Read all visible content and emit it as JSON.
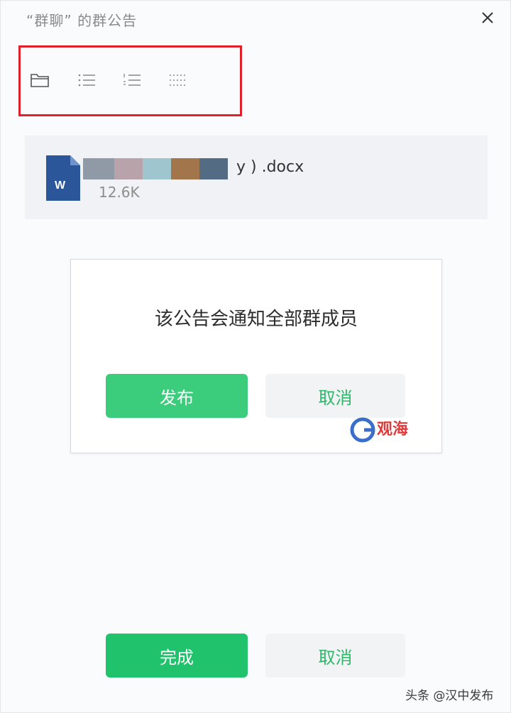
{
  "window": {
    "title": "“群聊” 的群公告"
  },
  "toolbar": {
    "tools": [
      {
        "icon": "folder-icon"
      },
      {
        "icon": "bullet-list-icon"
      },
      {
        "icon": "numbered-list-icon"
      },
      {
        "icon": "dotted-grid-icon"
      }
    ],
    "highlight_color": "#e0202a"
  },
  "attachment": {
    "file_type_letter": "W",
    "filename_visible": "y ) .docx",
    "size": "12.6K",
    "blur_colors": [
      "#8f9aa6",
      "#b8a3ab",
      "#9fc6cf",
      "#a2754a",
      "#546b84"
    ]
  },
  "confirm_dialog": {
    "message": "该公告会通知全部群成员",
    "publish_label": "发布",
    "cancel_label": "取消"
  },
  "footer": {
    "done_label": "完成",
    "cancel_label": "取消"
  },
  "watermark": {
    "logo_text": "观海"
  },
  "credit": {
    "text": "头条 @汉中发布"
  },
  "colors": {
    "accent_green": "#3ccd7c",
    "word_blue": "#2b579a"
  }
}
